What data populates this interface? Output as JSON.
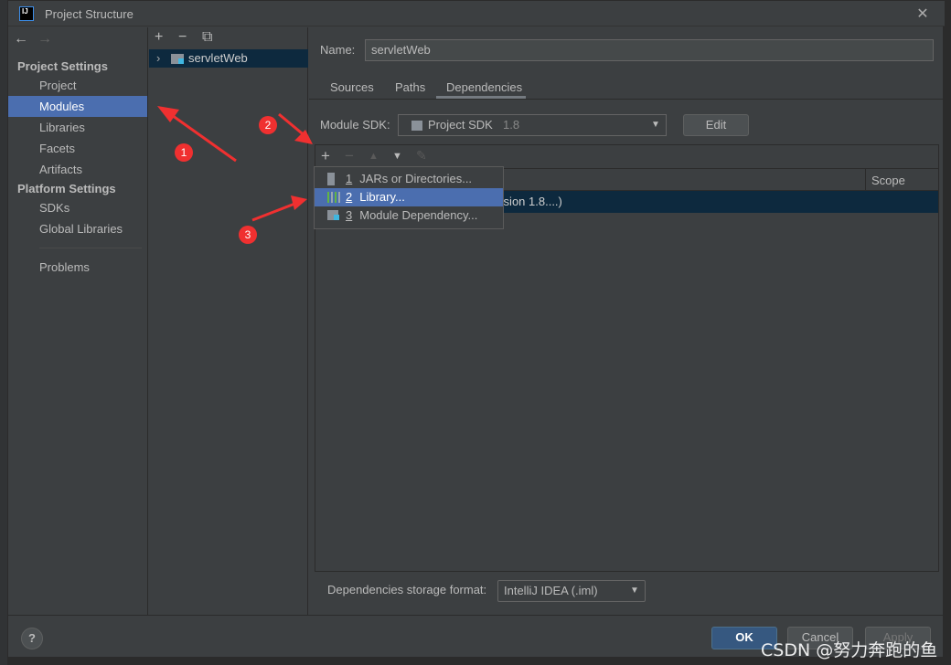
{
  "window": {
    "title": "Project Structure",
    "logo_text": "IJ",
    "close": "✕"
  },
  "sidebar": {
    "back": "←",
    "forward": "→",
    "project_settings": "Project Settings",
    "project_items": [
      {
        "label": "Project"
      },
      {
        "label": "Modules",
        "selected": true
      },
      {
        "label": "Libraries"
      },
      {
        "label": "Facets"
      },
      {
        "label": "Artifacts"
      }
    ],
    "platform_settings": "Platform Settings",
    "platform_items": [
      {
        "label": "SDKs"
      },
      {
        "label": "Global Libraries"
      }
    ],
    "problems": "Problems"
  },
  "modules": {
    "add": "+",
    "remove": "−",
    "copy": "⧉",
    "tree": [
      {
        "label": "servletWeb",
        "expanded": false
      }
    ]
  },
  "main": {
    "name_label": "Name:",
    "name_value": "servletWeb",
    "tabs": [
      {
        "label": "Sources"
      },
      {
        "label": "Paths"
      },
      {
        "label": "Dependencies",
        "active": true
      }
    ],
    "sdk_label": "Module SDK:",
    "sdk_value": "Project SDK",
    "sdk_version": "1.8",
    "edit": "Edit",
    "dep_toolbar": {
      "add": "+",
      "remove": "−",
      "up": "▲",
      "down": "▼",
      "edit": "✎"
    },
    "scope_header": "Scope",
    "dep_row_text": "ersion 1.8....)",
    "add_menu": [
      {
        "num": "1",
        "label": "JARs or Directories..."
      },
      {
        "num": "2",
        "label": "Library...",
        "selected": true
      },
      {
        "num": "3",
        "label": "Module Dependency..."
      }
    ],
    "storage_label": "Dependencies storage format:",
    "storage_value": "IntelliJ IDEA (.iml)"
  },
  "footer": {
    "help": "?",
    "ok": "OK",
    "cancel": "Cancel",
    "apply": "Apply"
  },
  "annotations": {
    "color": "#f03030",
    "markers": [
      "1",
      "2",
      "3"
    ]
  },
  "watermark": "CSDN @努力奔跑的鱼",
  "colors": {
    "selection": "#4b6eaf",
    "tree_selection": "#0d293e",
    "background": "#3c3f41"
  }
}
